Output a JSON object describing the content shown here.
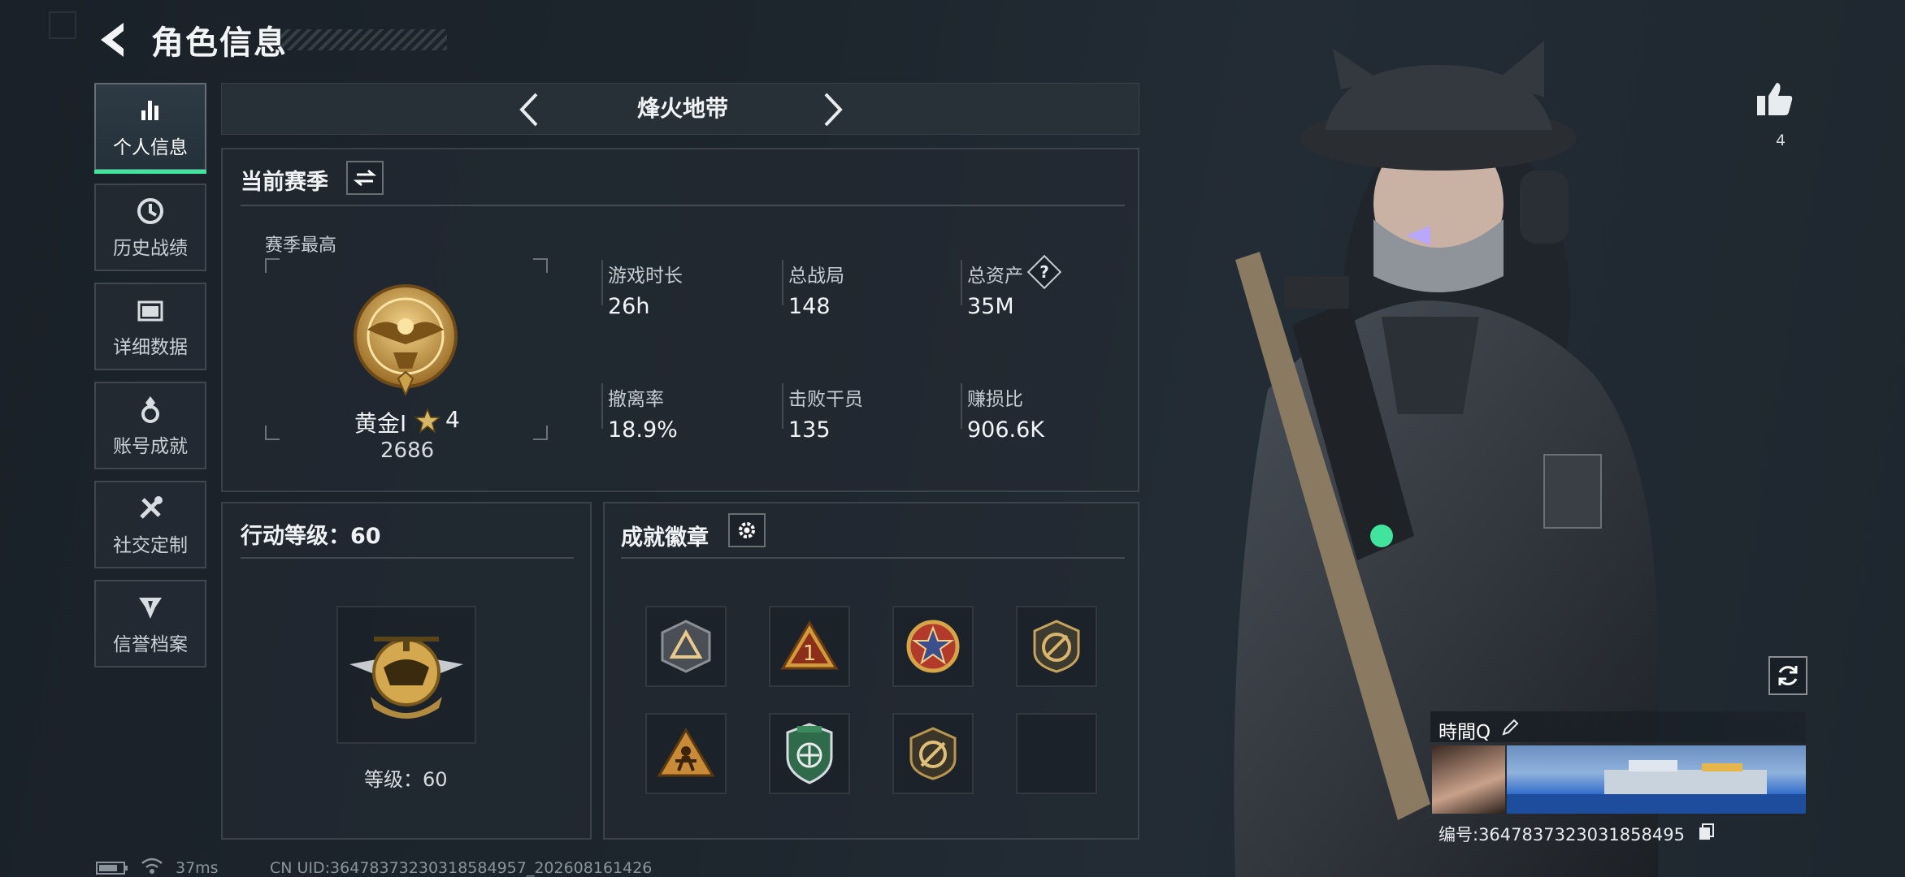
{
  "header": {
    "title": "角色信息"
  },
  "nav": [
    {
      "label": "个人信息",
      "active": true
    },
    {
      "label": "历史战绩",
      "active": false
    },
    {
      "label": "详细数据",
      "active": false
    },
    {
      "label": "账号成就",
      "active": false
    },
    {
      "label": "社交定制",
      "active": false
    },
    {
      "label": "信誉档案",
      "active": false
    }
  ],
  "mode": {
    "title": "烽火地带"
  },
  "season": {
    "title": "当前赛季",
    "best_label": "赛季最高",
    "rank_name": "黄金I",
    "rank_stars": "4",
    "rank_score": "2686",
    "stats": [
      {
        "label": "游戏时长",
        "value": "26h"
      },
      {
        "label": "总战局",
        "value": "148"
      },
      {
        "label": "总资产",
        "value": "35M",
        "help": "?"
      },
      {
        "label": "撤离率",
        "value": "18.9%"
      },
      {
        "label": "击败干员",
        "value": "135"
      },
      {
        "label": "赚损比",
        "value": "906.6K"
      }
    ]
  },
  "action_level": {
    "title": "行动等级：60",
    "caption": "等级：60"
  },
  "badges": {
    "title": "成就徽章",
    "slots": [
      "triangle-badge-icon",
      "gold-one-badge-icon",
      "star-medal-badge-icon",
      "no-gun-badge-icon",
      "climber-badge-icon",
      "green-shield-badge-icon",
      "crossed-circle-badge-icon",
      "empty"
    ]
  },
  "profile": {
    "likes": "4",
    "player_name": "時間Q",
    "player_id": "编号:3647837323031858495"
  },
  "footer": {
    "ping": "37ms",
    "uid": "CN UID:3647837323031858495​7_202608161426"
  },
  "colors": {
    "accent": "#3fe59c",
    "gold": "#c9a24a"
  }
}
